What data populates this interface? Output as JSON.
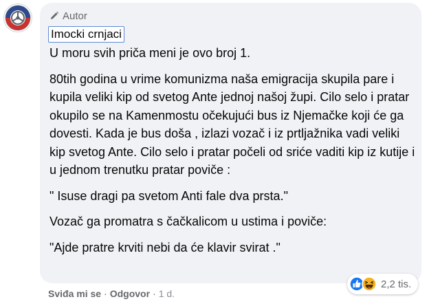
{
  "comment": {
    "author_badge": "Autor",
    "commenter_name": "Imocki crnjaci",
    "paragraphs": [
      "U moru svih priča meni je ovo broj 1.",
      "80tih godina u vrime komunizma naša emigracija skupila pare i kupila veliki kip od svetog Ante jednoj našoj župi. Cilo selo i pratar okupilo se na Kamenmostu očekujući bus iz Njemačke koji će ga dovesti. Kada je bus doša , izlazi vozač i iz prtljažnika vadi veliki kip svetog Ante. Cilo selo i pratar počeli od sriće vaditi kip iz kutije i u jednom trenutku pratar poviče :",
      "\" Isuse dragi pa svetom Anti fale dva prsta.\"",
      "Vozač ga promatra s čačkalicom u ustima i poviče:",
      "\"Ajde pratre krviti nebi da će klavir svirat .\""
    ],
    "avatar_icon": "steering-wheel-logo-icon",
    "author_icon": "pen-icon"
  },
  "actions": {
    "like_label": "Sviđa mi se",
    "separator": "·",
    "reply_label": "Odgovor",
    "timestamp": "1 d."
  },
  "reactions": {
    "icons": [
      "like-reaction-icon",
      "haha-reaction-icon"
    ],
    "count": "2,2 tis."
  },
  "colors": {
    "bubble": "#f0f2f5",
    "like_blue": "#1877f2",
    "haha_yellow": "#f7b125",
    "meta_gray": "#65676b"
  }
}
